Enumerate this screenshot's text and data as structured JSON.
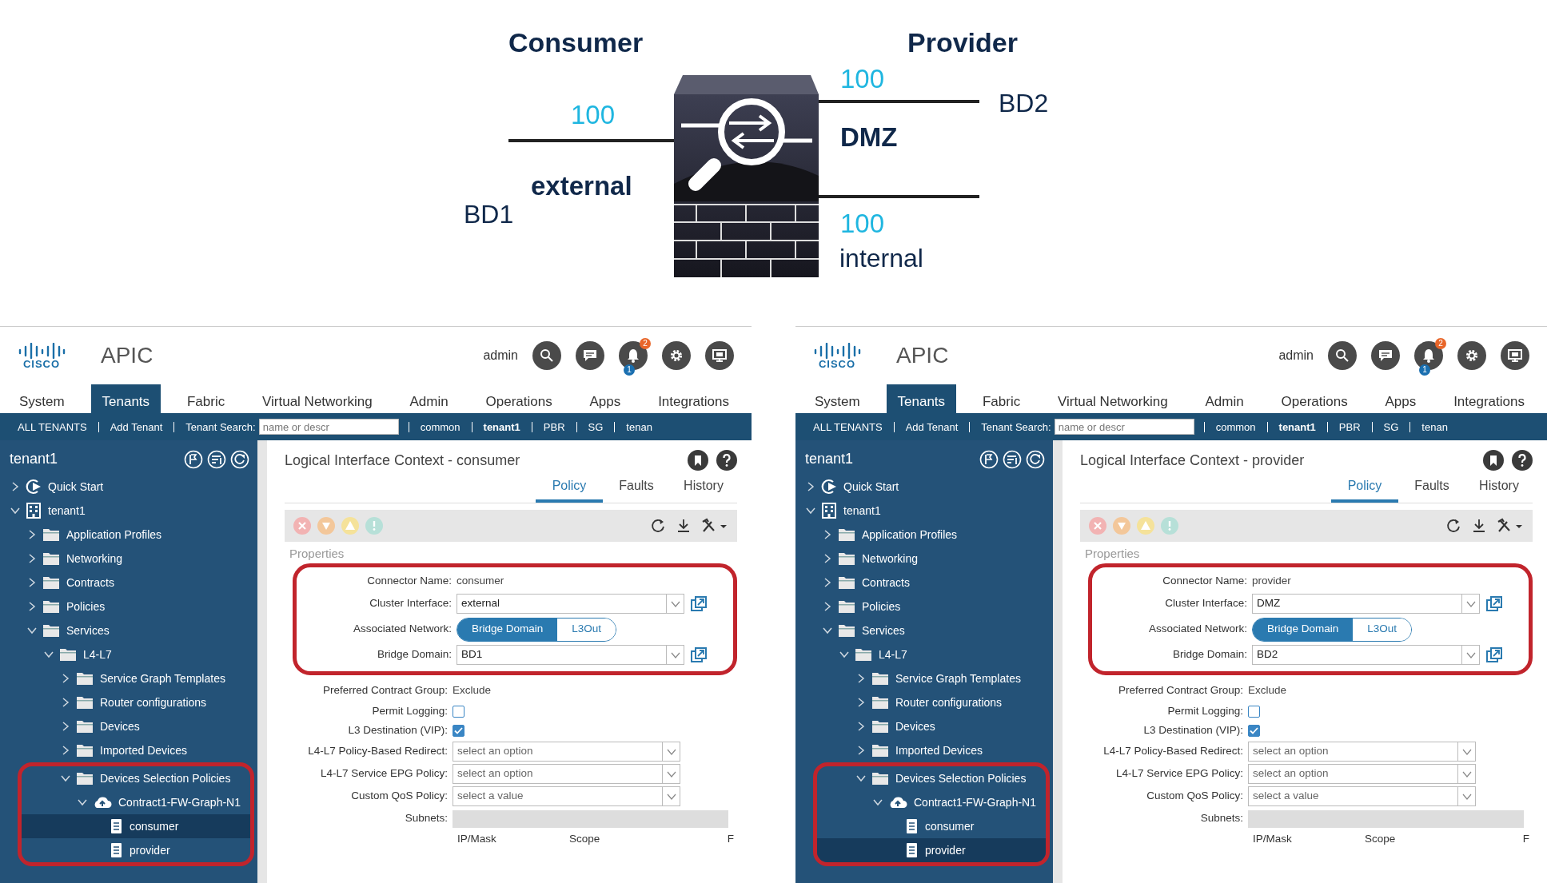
{
  "diagram": {
    "labels": [
      {
        "kind": "role",
        "text": "Consumer"
      },
      {
        "kind": "role",
        "text": "Provider"
      },
      {
        "kind": "metric",
        "text": "100"
      },
      {
        "kind": "interface",
        "text": "external"
      },
      {
        "kind": "domain",
        "text": "BD1"
      },
      {
        "kind": "metric",
        "text": "100"
      },
      {
        "kind": "domain",
        "text": "BD2"
      },
      {
        "kind": "interface",
        "text": "DMZ"
      },
      {
        "kind": "metric",
        "text": "100"
      },
      {
        "kind": "plain",
        "text": "internal"
      }
    ]
  },
  "panels": [
    {
      "header": {
        "logo_text": "CISCO",
        "app": "APIC",
        "user": "admin",
        "alert_badges": [
          "2",
          "1"
        ]
      },
      "tabs": [
        {
          "label": "System",
          "selected": false
        },
        {
          "label": "Tenants",
          "selected": true
        },
        {
          "label": "Fabric",
          "selected": false
        },
        {
          "label": "Virtual Networking",
          "selected": false
        },
        {
          "label": "Admin",
          "selected": false
        },
        {
          "label": "Operations",
          "selected": false
        },
        {
          "label": "Apps",
          "selected": false
        },
        {
          "label": "Integrations",
          "selected": false
        }
      ],
      "tenant_bar": [
        {
          "kind": "link",
          "text": "ALL TENANTS",
          "selected": false
        },
        {
          "kind": "link",
          "text": "Add Tenant",
          "selected": false
        },
        {
          "kind": "search",
          "label": "Tenant Search:",
          "placeholder": "name or descr"
        },
        {
          "kind": "link",
          "text": "common",
          "selected": false
        },
        {
          "kind": "link",
          "text": "tenant1",
          "selected": true
        },
        {
          "kind": "link",
          "text": "PBR",
          "selected": false
        },
        {
          "kind": "link",
          "text": "SG",
          "selected": false
        },
        {
          "kind": "link",
          "text": "tenan",
          "selected": false
        }
      ],
      "sidebar": {
        "title": "tenant1",
        "tree": [
          {
            "kind": "quickstart",
            "label": "Quick Start",
            "expanded": false,
            "selected": false,
            "highlighted": false
          },
          {
            "kind": "tenant",
            "label": "tenant1",
            "expanded": true,
            "selected": false,
            "highlighted": false,
            "children": [
              {
                "kind": "folder",
                "label": "Application Profiles",
                "expanded": false,
                "selected": false,
                "highlighted": false
              },
              {
                "kind": "folder",
                "label": "Networking",
                "expanded": false,
                "selected": false,
                "highlighted": false
              },
              {
                "kind": "folder",
                "label": "Contracts",
                "expanded": false,
                "selected": false,
                "highlighted": false
              },
              {
                "kind": "folder",
                "label": "Policies",
                "expanded": false,
                "selected": false,
                "highlighted": false
              },
              {
                "kind": "folder",
                "label": "Services",
                "expanded": true,
                "selected": false,
                "highlighted": false,
                "children": [
                  {
                    "kind": "folder",
                    "label": "L4-L7",
                    "expanded": true,
                    "selected": false,
                    "highlighted": false,
                    "children": [
                      {
                        "kind": "folder",
                        "label": "Service Graph Templates",
                        "expanded": false,
                        "selected": false,
                        "highlighted": false
                      },
                      {
                        "kind": "folder",
                        "label": "Router configurations",
                        "expanded": false,
                        "selected": false,
                        "highlighted": false
                      },
                      {
                        "kind": "folder",
                        "label": "Devices",
                        "expanded": false,
                        "selected": false,
                        "highlighted": false
                      },
                      {
                        "kind": "folder",
                        "label": "Imported Devices",
                        "expanded": false,
                        "selected": false,
                        "highlighted": false
                      },
                      {
                        "kind": "folder",
                        "label": "Devices Selection Policies",
                        "expanded": true,
                        "selected": false,
                        "highlighted": true,
                        "children": [
                          {
                            "kind": "cloud",
                            "label": "Contract1-FW-Graph-N1",
                            "expanded": true,
                            "selected": false,
                            "highlighted": false,
                            "children": [
                              {
                                "kind": "document",
                                "label": "consumer",
                                "selected": true,
                                "highlighted": false
                              },
                              {
                                "kind": "document",
                                "label": "provider",
                                "selected": false,
                                "highlighted": false
                              }
                            ]
                          }
                        ]
                      }
                    ]
                  }
                ]
              }
            ]
          }
        ]
      },
      "content": {
        "title": "Logical Interface Context - consumer",
        "tabs": [
          {
            "label": "Policy",
            "selected": true
          },
          {
            "label": "Faults",
            "selected": false
          },
          {
            "label": "History",
            "selected": false
          }
        ],
        "heading": "Properties",
        "groups": [
          {
            "highlighted": true,
            "fields": [
              {
                "kind": "text",
                "label": "Connector Name:",
                "value": "consumer"
              },
              {
                "kind": "select",
                "label": "Cluster Interface:",
                "value": "external",
                "link_icon": true
              },
              {
                "kind": "toggle",
                "label": "Associated Network:",
                "options": [
                  {
                    "label": "Bridge Domain",
                    "selected": true
                  },
                  {
                    "label": "L3Out",
                    "selected": false
                  }
                ]
              },
              {
                "kind": "select",
                "label": "Bridge Domain:",
                "value": "BD1",
                "link_icon": true
              }
            ]
          },
          {
            "highlighted": false,
            "fields": [
              {
                "kind": "text",
                "label": "Preferred Contract Group:",
                "value": "Exclude"
              },
              {
                "kind": "checkbox",
                "label": "Permit Logging:",
                "checked": false
              },
              {
                "kind": "checkbox",
                "label": "L3 Destination (VIP):",
                "checked": true
              },
              {
                "kind": "select",
                "label": "L4-L7 Policy-Based Redirect:",
                "placeholder": "select an option",
                "link_icon": false
              },
              {
                "kind": "select",
                "label": "L4-L7 Service EPG Policy:",
                "placeholder": "select an option",
                "link_icon": false
              },
              {
                "kind": "select",
                "label": "Custom QoS Policy:",
                "placeholder": "select a value",
                "link_icon": false
              },
              {
                "kind": "table",
                "label": "Subnets:",
                "columns": [
                  "IP/Mask",
                  "Scope",
                  "F"
                ]
              }
            ]
          }
        ]
      }
    },
    {
      "header": {
        "logo_text": "CISCO",
        "app": "APIC",
        "user": "admin",
        "alert_badges": [
          "2",
          "1"
        ]
      },
      "tabs": [
        {
          "label": "System",
          "selected": false
        },
        {
          "label": "Tenants",
          "selected": true
        },
        {
          "label": "Fabric",
          "selected": false
        },
        {
          "label": "Virtual Networking",
          "selected": false
        },
        {
          "label": "Admin",
          "selected": false
        },
        {
          "label": "Operations",
          "selected": false
        },
        {
          "label": "Apps",
          "selected": false
        },
        {
          "label": "Integrations",
          "selected": false
        }
      ],
      "tenant_bar": [
        {
          "kind": "link",
          "text": "ALL TENANTS",
          "selected": false
        },
        {
          "kind": "link",
          "text": "Add Tenant",
          "selected": false
        },
        {
          "kind": "search",
          "label": "Tenant Search:",
          "placeholder": "name or descr"
        },
        {
          "kind": "link",
          "text": "common",
          "selected": false
        },
        {
          "kind": "link",
          "text": "tenant1",
          "selected": true
        },
        {
          "kind": "link",
          "text": "PBR",
          "selected": false
        },
        {
          "kind": "link",
          "text": "SG",
          "selected": false
        },
        {
          "kind": "link",
          "text": "tenan",
          "selected": false
        }
      ],
      "sidebar": {
        "title": "tenant1",
        "tree": [
          {
            "kind": "quickstart",
            "label": "Quick Start",
            "expanded": false,
            "selected": false,
            "highlighted": false
          },
          {
            "kind": "tenant",
            "label": "tenant1",
            "expanded": true,
            "selected": false,
            "highlighted": false,
            "children": [
              {
                "kind": "folder",
                "label": "Application Profiles",
                "expanded": false,
                "selected": false,
                "highlighted": false
              },
              {
                "kind": "folder",
                "label": "Networking",
                "expanded": false,
                "selected": false,
                "highlighted": false
              },
              {
                "kind": "folder",
                "label": "Contracts",
                "expanded": false,
                "selected": false,
                "highlighted": false
              },
              {
                "kind": "folder",
                "label": "Policies",
                "expanded": false,
                "selected": false,
                "highlighted": false
              },
              {
                "kind": "folder",
                "label": "Services",
                "expanded": true,
                "selected": false,
                "highlighted": false,
                "children": [
                  {
                    "kind": "folder",
                    "label": "L4-L7",
                    "expanded": true,
                    "selected": false,
                    "highlighted": false,
                    "children": [
                      {
                        "kind": "folder",
                        "label": "Service Graph Templates",
                        "expanded": false,
                        "selected": false,
                        "highlighted": false
                      },
                      {
                        "kind": "folder",
                        "label": "Router configurations",
                        "expanded": false,
                        "selected": false,
                        "highlighted": false
                      },
                      {
                        "kind": "folder",
                        "label": "Devices",
                        "expanded": false,
                        "selected": false,
                        "highlighted": false
                      },
                      {
                        "kind": "folder",
                        "label": "Imported Devices",
                        "expanded": false,
                        "selected": false,
                        "highlighted": false
                      },
                      {
                        "kind": "folder",
                        "label": "Devices Selection Policies",
                        "expanded": true,
                        "selected": false,
                        "highlighted": true,
                        "children": [
                          {
                            "kind": "cloud",
                            "label": "Contract1-FW-Graph-N1",
                            "expanded": true,
                            "selected": false,
                            "highlighted": false,
                            "children": [
                              {
                                "kind": "document",
                                "label": "consumer",
                                "selected": false,
                                "highlighted": false
                              },
                              {
                                "kind": "document",
                                "label": "provider",
                                "selected": true,
                                "highlighted": false
                              }
                            ]
                          }
                        ]
                      }
                    ]
                  }
                ]
              }
            ]
          }
        ]
      },
      "content": {
        "title": "Logical Interface Context - provider",
        "tabs": [
          {
            "label": "Policy",
            "selected": true
          },
          {
            "label": "Faults",
            "selected": false
          },
          {
            "label": "History",
            "selected": false
          }
        ],
        "heading": "Properties",
        "groups": [
          {
            "highlighted": true,
            "fields": [
              {
                "kind": "text",
                "label": "Connector Name:",
                "value": "provider"
              },
              {
                "kind": "select",
                "label": "Cluster Interface:",
                "value": "DMZ",
                "link_icon": true
              },
              {
                "kind": "toggle",
                "label": "Associated Network:",
                "options": [
                  {
                    "label": "Bridge Domain",
                    "selected": true
                  },
                  {
                    "label": "L3Out",
                    "selected": false
                  }
                ]
              },
              {
                "kind": "select",
                "label": "Bridge Domain:",
                "value": "BD2",
                "link_icon": true
              }
            ]
          },
          {
            "highlighted": false,
            "fields": [
              {
                "kind": "text",
                "label": "Preferred Contract Group:",
                "value": "Exclude"
              },
              {
                "kind": "checkbox",
                "label": "Permit Logging:",
                "checked": false
              },
              {
                "kind": "checkbox",
                "label": "L3 Destination (VIP):",
                "checked": true
              },
              {
                "kind": "select",
                "label": "L4-L7 Policy-Based Redirect:",
                "placeholder": "select an option",
                "link_icon": false
              },
              {
                "kind": "select",
                "label": "L4-L7 Service EPG Policy:",
                "placeholder": "select an option",
                "link_icon": false
              },
              {
                "kind": "select",
                "label": "Custom QoS Policy:",
                "placeholder": "select a value",
                "link_icon": false
              },
              {
                "kind": "table",
                "label": "Subnets:",
                "columns": [
                  "IP/Mask",
                  "Scope",
                  "F"
                ]
              }
            ]
          }
        ]
      }
    }
  ]
}
